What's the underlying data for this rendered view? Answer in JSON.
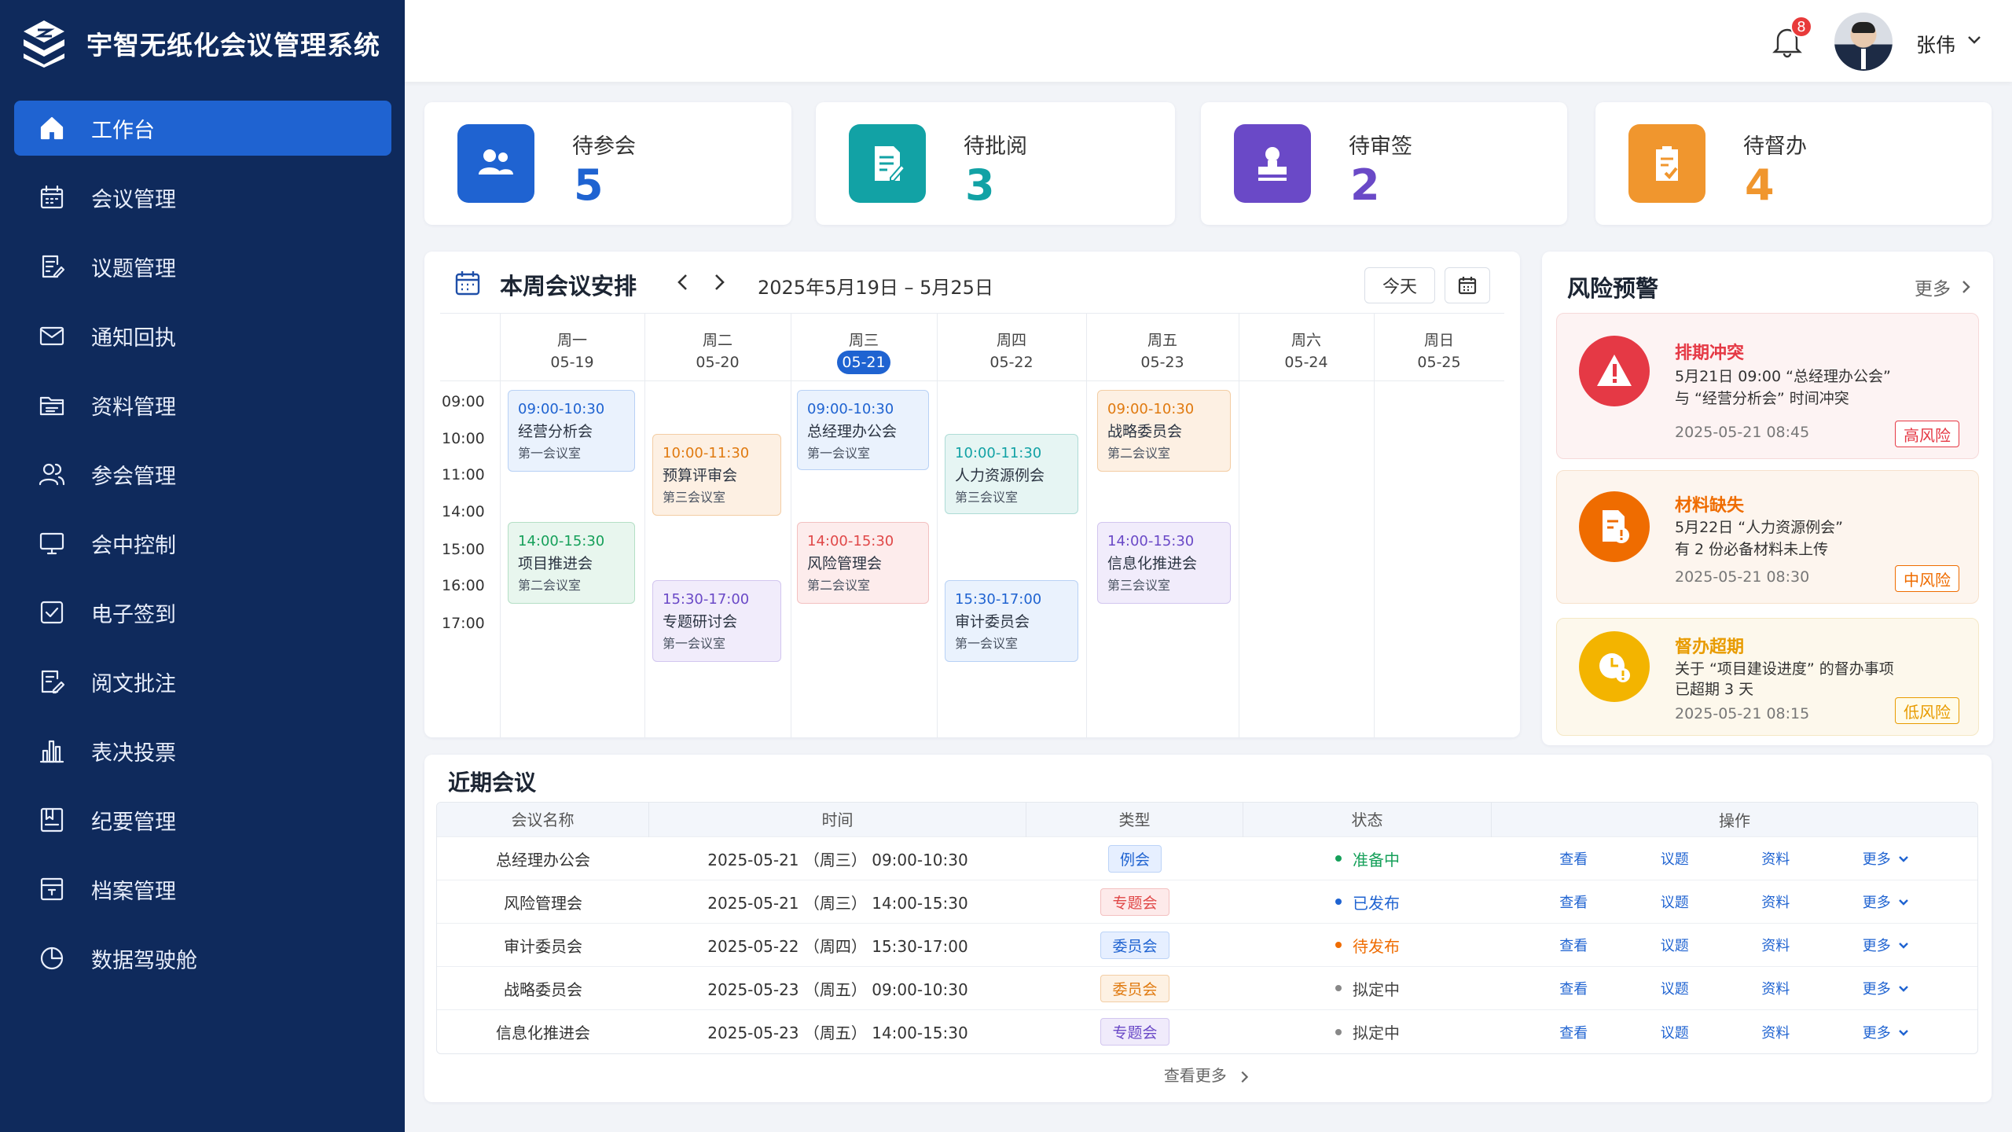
{
  "app": {
    "title": "宇智无纸化会议管理系统"
  },
  "sidebar": {
    "items": [
      {
        "label": "工作台",
        "icon": "home-icon",
        "active": true
      },
      {
        "label": "会议管理",
        "icon": "calendar-icon"
      },
      {
        "label": "议题管理",
        "icon": "document-edit-icon"
      },
      {
        "label": "通知回执",
        "icon": "mail-icon"
      },
      {
        "label": "资料管理",
        "icon": "folder-icon"
      },
      {
        "label": "参会管理",
        "icon": "users-icon"
      },
      {
        "label": "会中控制",
        "icon": "monitor-icon"
      },
      {
        "label": "电子签到",
        "icon": "checkbox-icon"
      },
      {
        "label": "阅文批注",
        "icon": "annotate-icon"
      },
      {
        "label": "表决投票",
        "icon": "bar-chart-icon"
      },
      {
        "label": "纪要管理",
        "icon": "minutes-icon"
      },
      {
        "label": "档案管理",
        "icon": "archive-icon"
      },
      {
        "label": "数据驾驶舱",
        "icon": "pie-chart-icon"
      }
    ]
  },
  "header": {
    "notification_count": "8",
    "username": "张伟"
  },
  "stats": [
    {
      "label": "待参会",
      "value": "5",
      "color": "#1f63d1",
      "icon": "users-icon"
    },
    {
      "label": "待批阅",
      "value": "3",
      "color": "#12a2a5",
      "icon": "review-icon"
    },
    {
      "label": "待审签",
      "value": "2",
      "color": "#6a49c7",
      "icon": "stamp-icon"
    },
    {
      "label": "待督办",
      "value": "4",
      "color": "#f0962e",
      "icon": "clipboard-check-icon"
    }
  ],
  "schedule": {
    "title": "本周会议安排",
    "range": "2025年5月19日 – 5月25日",
    "today_label": "今天",
    "days": [
      {
        "weekday": "周一",
        "date": "05-19"
      },
      {
        "weekday": "周二",
        "date": "05-20"
      },
      {
        "weekday": "周三",
        "date": "05-21"
      },
      {
        "weekday": "周四",
        "date": "05-22"
      },
      {
        "weekday": "周五",
        "date": "05-23"
      },
      {
        "weekday": "周六",
        "date": "05-24"
      },
      {
        "weekday": "周日",
        "date": "05-25"
      }
    ],
    "times": [
      "09:00",
      "10:00",
      "11:00",
      "14:00",
      "15:00",
      "16:00",
      "17:00"
    ],
    "events": [
      {
        "time": "09:00-10:30",
        "name": "经营分析会",
        "room": "第一会议室",
        "theme": "blue"
      },
      {
        "time": "14:00-15:30",
        "name": "项目推进会",
        "room": "第二会议室",
        "theme": "green"
      },
      {
        "time": "10:00-11:30",
        "name": "预算评审会",
        "room": "第三会议室",
        "theme": "orange"
      },
      {
        "time": "15:30-17:00",
        "name": "专题研讨会",
        "room": "第一会议室",
        "theme": "purple"
      },
      {
        "time": "09:00-10:30",
        "name": "总经理办公会",
        "room": "第一会议室",
        "theme": "blue"
      },
      {
        "time": "14:00-15:30",
        "name": "风险管理会",
        "room": "第二会议室",
        "theme": "red"
      },
      {
        "time": "10:00-11:30",
        "name": "人力资源例会",
        "room": "第三会议室",
        "theme": "teal"
      },
      {
        "time": "15:30-17:00",
        "name": "审计委员会",
        "room": "第一会议室",
        "theme": "blue"
      },
      {
        "time": "09:00-10:30",
        "name": "战略委员会",
        "room": "第二会议室",
        "theme": "orange"
      },
      {
        "time": "14:00-15:30",
        "name": "信息化推进会",
        "room": "第三会议室",
        "theme": "purple"
      }
    ]
  },
  "risk": {
    "title": "风险预警",
    "more_label": "更多",
    "items": [
      {
        "title": "排期冲突",
        "line1": "5月21日 09:00 “总经理办公会”",
        "line2": "与 “经营分析会” 时间冲突",
        "time": "2025-05-21 08:45",
        "level": "高风险",
        "color": "#e53945",
        "icon": "warning-icon"
      },
      {
        "title": "材料缺失",
        "line1": "5月22日 “人力资源例会”",
        "line2": "有 2 份必备材料未上传",
        "time": "2025-05-21 08:30",
        "level": "中风险",
        "color": "#ef6c00",
        "icon": "missing-file-icon"
      },
      {
        "title": "督办超期",
        "line1": "关于 “项目建设进度” 的督办事项",
        "line2": "已超期 3 天",
        "time": "2025-05-21 08:15",
        "level": "低风险",
        "color": "#e89b00",
        "icon": "clock-alert-icon"
      }
    ]
  },
  "recent": {
    "title": "近期会议",
    "columns": [
      "会议名称",
      "时间",
      "类型",
      "状态",
      "操作"
    ],
    "actions": [
      "查看",
      "议题",
      "资料",
      "更多"
    ],
    "rows": [
      {
        "name": "总经理办公会",
        "time": "2025-05-21 （周三） 09:00-10:30",
        "type": "例会",
        "type_theme": "blue",
        "status": "准备中",
        "status_color": "#16a05a"
      },
      {
        "name": "风险管理会",
        "time": "2025-05-21 （周三） 14:00-15:30",
        "type": "专题会",
        "type_theme": "red",
        "status": "已发布",
        "status_color": "#1f63d1"
      },
      {
        "name": "审计委员会",
        "time": "2025-05-22 （周四） 15:30-17:00",
        "type": "委员会",
        "type_theme": "blue",
        "status": "待发布",
        "status_color": "#ef6c00"
      },
      {
        "name": "战略委员会",
        "time": "2025-05-23 （周五） 09:00-10:30",
        "type": "委员会",
        "type_theme": "orange",
        "status": "拟定中",
        "status_color": "#888888"
      },
      {
        "name": "信息化推进会",
        "time": "2025-05-23 （周五） 14:00-15:30",
        "type": "专题会",
        "type_theme": "purple",
        "status": "拟定中",
        "status_color": "#888888"
      }
    ],
    "view_more": "查看更多"
  }
}
